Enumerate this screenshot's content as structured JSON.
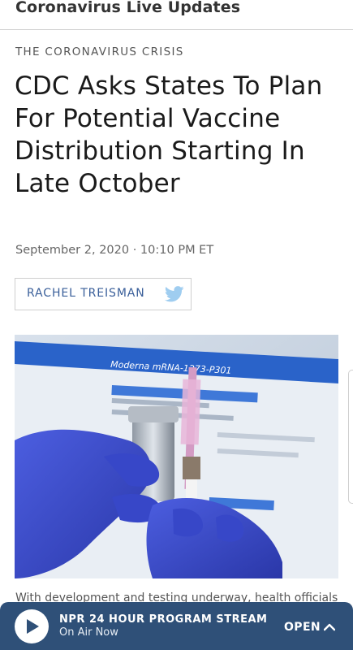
{
  "topbar": {
    "title": "Coronavirus Live Updates"
  },
  "article": {
    "section": "THE CORONAVIRUS CRISIS",
    "headline": "CDC Asks States To Plan For Potential Vaccine Distribution Starting In Late October",
    "dateline": "September 2, 2020 · 10:10 PM ET",
    "author": "RACHEL TREISMAN",
    "photo_screen_text": "Moderna mRNA-1273-P301",
    "caption": "With development and testing underway, health officials are"
  },
  "player": {
    "title": "NPR 24 HOUR PROGRAM STREAM",
    "subtitle": "On Air Now",
    "open_label": "OPEN"
  },
  "icons": {
    "play": "play-icon",
    "twitter": "twitter-icon",
    "chevron": "chevron-up-icon"
  },
  "colors": {
    "player_bg": "#2f5078",
    "author_link": "#3a5f9a",
    "twitter_blue": "#9fcdf0"
  }
}
